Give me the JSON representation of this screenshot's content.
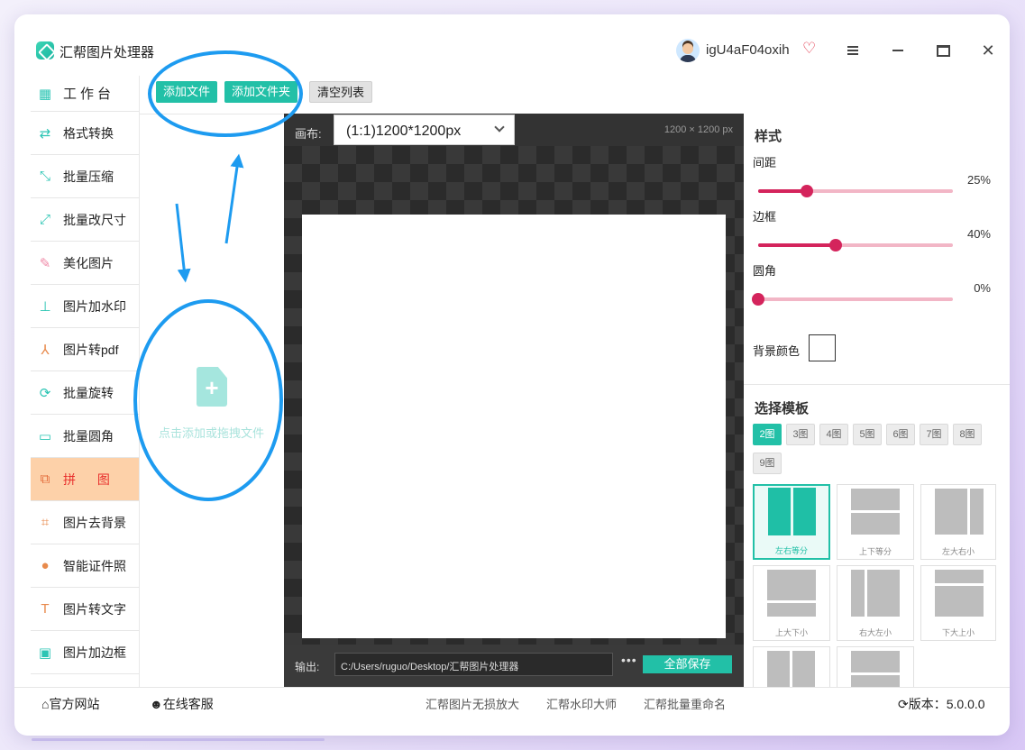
{
  "app": {
    "title": "汇帮图片处理器",
    "username": "igU4aF04oxih"
  },
  "sidebar": {
    "items": [
      {
        "label": "工作台",
        "icon": "grid-icon"
      },
      {
        "label": "格式转换",
        "icon": "convert-icon"
      },
      {
        "label": "批量压缩",
        "icon": "compress-icon"
      },
      {
        "label": "批量改尺寸",
        "icon": "resize-icon"
      },
      {
        "label": "美化图片",
        "icon": "beautify-icon"
      },
      {
        "label": "图片加水印",
        "icon": "watermark-icon"
      },
      {
        "label": "图片转pdf",
        "icon": "pdf-icon"
      },
      {
        "label": "批量旋转",
        "icon": "rotate-icon"
      },
      {
        "label": "批量圆角",
        "icon": "rounded-corner-icon"
      },
      {
        "label": "拼 图",
        "icon": "collage-icon"
      },
      {
        "label": "图片去背景",
        "icon": "crop-icon"
      },
      {
        "label": "智能证件照",
        "icon": "person-icon"
      },
      {
        "label": "图片转文字",
        "icon": "text-icon"
      },
      {
        "label": "图片加边框",
        "icon": "frame-icon"
      }
    ],
    "active_index": 9
  },
  "toolbar": {
    "add_file": "添加文件",
    "add_folder": "添加文件夹",
    "clear_list": "清空列表"
  },
  "drop_zone": {
    "hint": "点击添加或拖拽文件"
  },
  "canvas": {
    "label": "画布:",
    "selected": "(1:1)1200*1200px",
    "size_text": "1200 × 1200 px",
    "output_label": "输出:",
    "output_path": "C:/Users/ruguo/Desktop/汇帮图片处理器",
    "more": "•••",
    "save_all": "全部保存"
  },
  "style_panel": {
    "title": "样式",
    "spacing": {
      "label": "间距",
      "value": 25,
      "text": "25%"
    },
    "border": {
      "label": "边框",
      "value": 40,
      "text": "40%"
    },
    "radius": {
      "label": "圆角",
      "value": 0,
      "text": "0%"
    },
    "bg_color_label": "背景颜色",
    "bg_color": "#ffffff"
  },
  "template_panel": {
    "title": "选择模板",
    "tabs": [
      "2图",
      "3图",
      "4图",
      "5图",
      "6图",
      "7图",
      "8图",
      "9图"
    ],
    "active_tab": 0,
    "templates": [
      "左右等分",
      "上下等分",
      "左大右小",
      "上大下小",
      "右大左小",
      "下大上小",
      "",
      ""
    ],
    "active_template": 0
  },
  "footer": {
    "website": "官方网站",
    "support": "在线客服",
    "links": [
      "汇帮图片无损放大",
      "汇帮水印大师",
      "汇帮批量重命名"
    ],
    "version": "版本：5.0.0.0"
  },
  "colors": {
    "accent": "#22c0a7",
    "slider": "#d4245c",
    "active_nav_bg": "#fdd1a9",
    "annotation": "#1d9bf0"
  }
}
